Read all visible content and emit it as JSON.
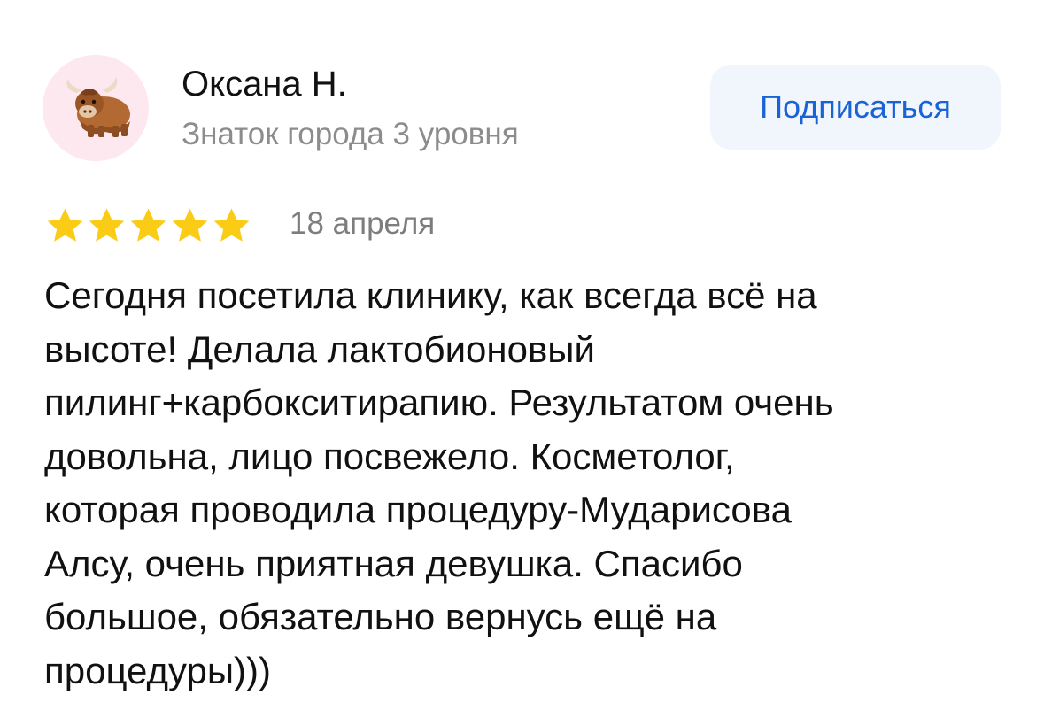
{
  "author": {
    "name": "Оксана Н.",
    "level": "Знаток города 3 уровня",
    "avatar_icon": "yak-icon",
    "avatar_background": "#fde8ef"
  },
  "subscribe_button": {
    "label": "Подписаться",
    "color": "#1a63d6",
    "background": "#f1f5fc"
  },
  "rating": {
    "stars": 5,
    "max": 5,
    "star_icon": "star-icon",
    "star_color": "#fbcc15"
  },
  "date": "18 апреля",
  "text": "Сегодня посетила клинику, как всегда всё на\nвысоте! Делала лактобионовый\nпилинг+карбокситирапию. Результатом очень\nдовольна, лицо посвежело. Косметолог,\nкоторая проводила процедуру-Мударисова\nАлсу, очень приятная девушка. Спасибо\nбольшое, обязательно вернусь ещё на\nпроцедуры)))"
}
